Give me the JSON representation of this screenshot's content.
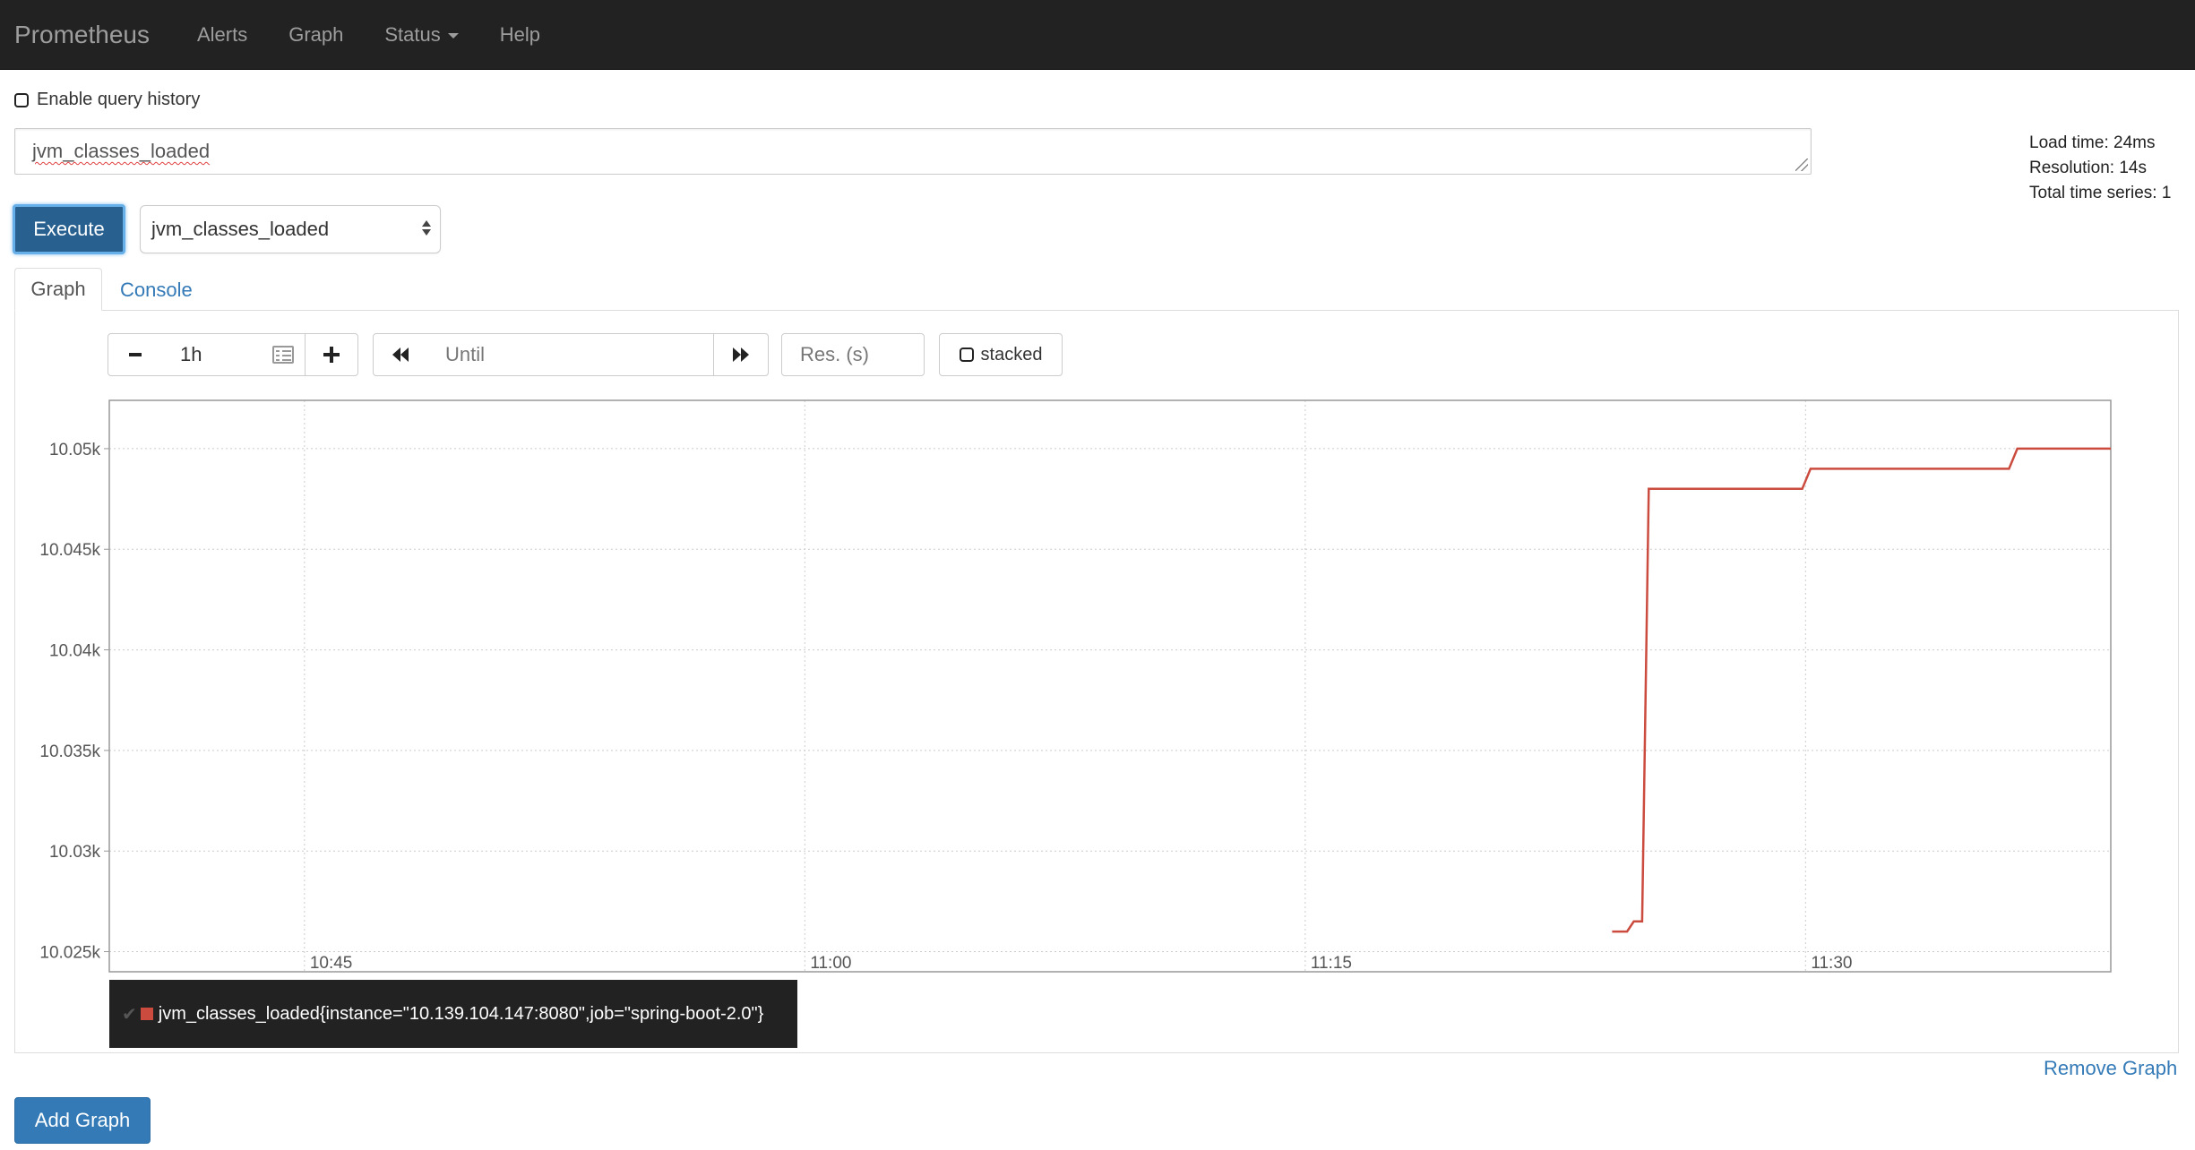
{
  "navbar": {
    "brand": "Prometheus",
    "items": [
      {
        "label": "Alerts"
      },
      {
        "label": "Graph"
      },
      {
        "label": "Status",
        "dropdown": true
      },
      {
        "label": "Help"
      }
    ]
  },
  "history": {
    "label": "Enable query history",
    "checked": false
  },
  "expression": {
    "value": "jvm_classes_loaded"
  },
  "stats": {
    "load_time": "Load time: 24ms",
    "resolution": "Resolution: 14s",
    "total_series": "Total time series: 1"
  },
  "execute_label": "Execute",
  "metric_select": {
    "selected": "jvm_classes_loaded"
  },
  "tabs": [
    {
      "label": "Graph",
      "active": true
    },
    {
      "label": "Console",
      "active": false
    }
  ],
  "controls": {
    "range": "1h",
    "until_placeholder": "Until",
    "resolution_placeholder": "Res. (s)",
    "stacked_label": "stacked"
  },
  "chart_data": {
    "type": "line",
    "y_ticks": [
      {
        "value": 10050,
        "label": "10.05k"
      },
      {
        "value": 10045,
        "label": "10.045k"
      },
      {
        "value": 10040,
        "label": "10.04k"
      },
      {
        "value": 10035,
        "label": "10.035k"
      },
      {
        "value": 10030,
        "label": "10.03k"
      },
      {
        "value": 10025,
        "label": "10.025k"
      }
    ],
    "x_ticks": [
      {
        "value": 45,
        "label": "10:45"
      },
      {
        "value": 60,
        "label": "11:00"
      },
      {
        "value": 75,
        "label": "11:15"
      },
      {
        "value": 90,
        "label": "11:30"
      }
    ],
    "xlim": [
      39.15,
      99.15
    ],
    "ylim": [
      10024,
      10052.4
    ],
    "grid": true,
    "series": [
      {
        "name": "jvm_classes_loaded{instance=\"10.139.104.147:8080\",job=\"spring-boot-2.0\"}",
        "color": "#cb4b3f",
        "points": [
          [
            84.2,
            10026
          ],
          [
            84.65,
            10026
          ],
          [
            84.85,
            10026.5
          ],
          [
            85.1,
            10026.5
          ],
          [
            85.3,
            10048
          ],
          [
            89.9,
            10048
          ],
          [
            90.15,
            10049
          ],
          [
            96.1,
            10049
          ],
          [
            96.35,
            10050
          ],
          [
            99.15,
            10050
          ]
        ]
      }
    ]
  },
  "legend": {
    "entries": [
      {
        "label": "jvm_classes_loaded{instance=\"10.139.104.147:8080\",job=\"spring-boot-2.0\"}",
        "color": "#cb4b3f"
      }
    ]
  },
  "remove_graph_label": "Remove Graph",
  "add_graph_label": "Add Graph"
}
